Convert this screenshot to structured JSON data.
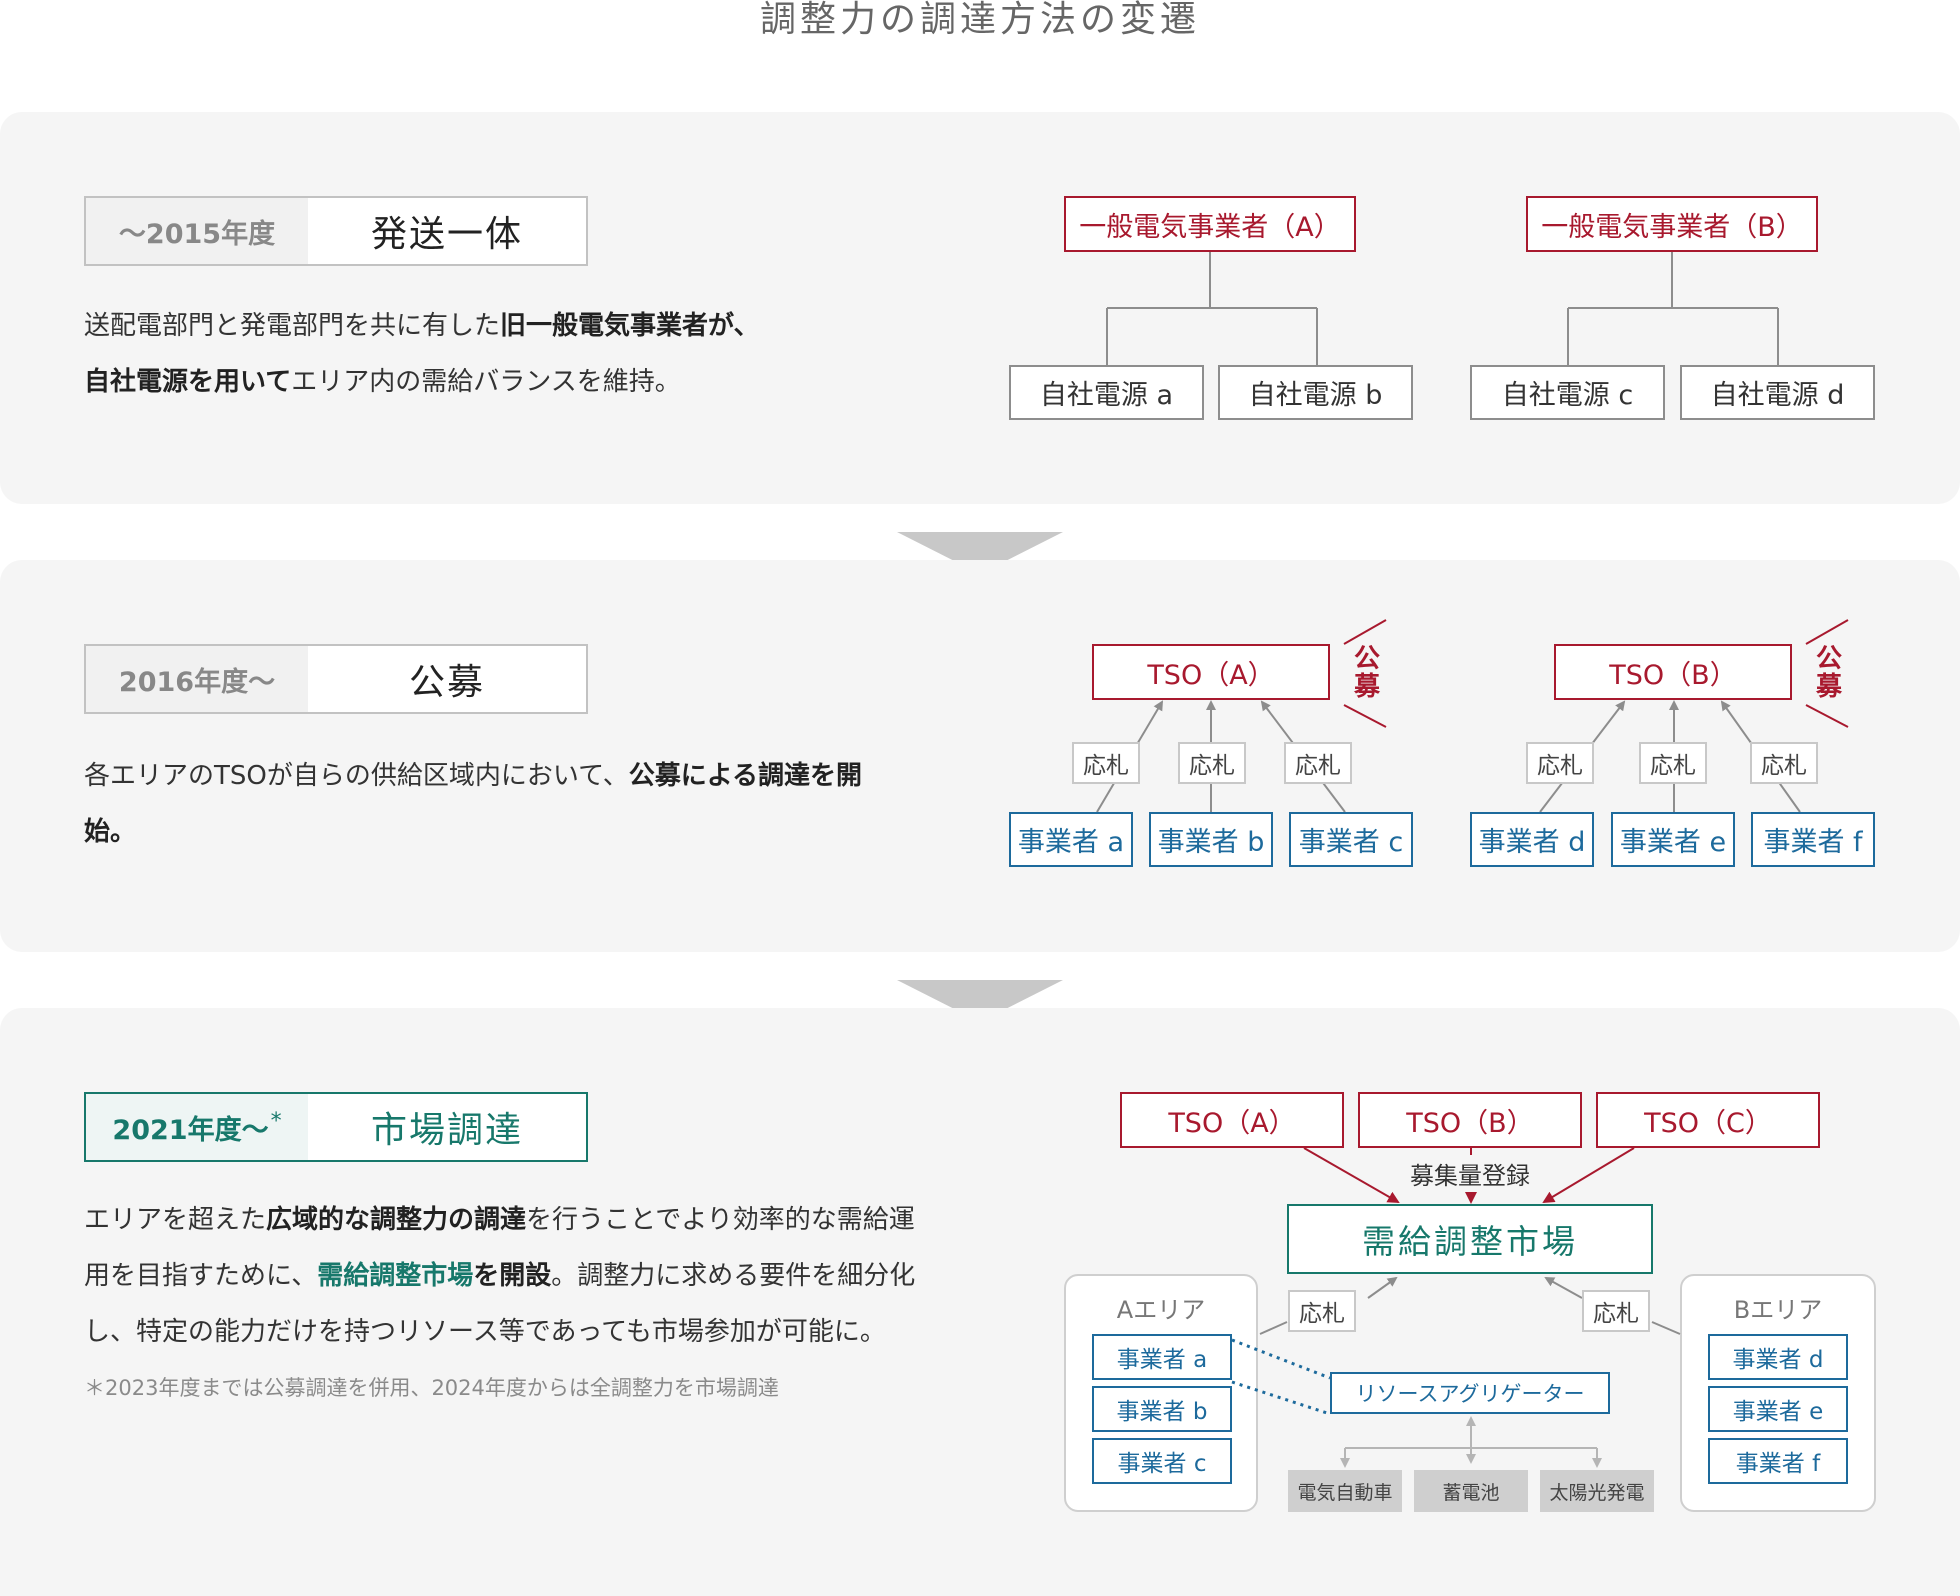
{
  "title": "調整力の調達方法の変遷",
  "colors": {
    "red": "#a8192e",
    "blue": "#1d6a9c",
    "green": "#17786b",
    "panel": "#f5f5f5"
  },
  "s1": {
    "year": "～2015年度",
    "name": "発送一体",
    "desc": {
      "l1a": "送配電部門と発電部門を共に有した",
      "l1b": "旧一般電気事業者が、",
      "l2a": "自社電源を用いて",
      "l2b": "エリア内の需給バランスを維持。"
    },
    "utilA": "一般電気事業者（A）",
    "utilB": "一般電気事業者（B）",
    "sources": [
      "自社電源 a",
      "自社電源 b",
      "自社電源 c",
      "自社電源 d"
    ]
  },
  "s2": {
    "year": "2016年度～",
    "name": "公募",
    "desc": {
      "l1a": "各エリアのTSOが自らの供給区域内において、",
      "l1b": "公募による調達を開",
      "l2": "始。"
    },
    "tsoA": "TSO（A）",
    "tsoB": "TSO（B）",
    "koubo": "公募",
    "bid": "応札",
    "operators": [
      "事業者 a",
      "事業者 b",
      "事業者 c",
      "事業者 d",
      "事業者 e",
      "事業者 f"
    ]
  },
  "s3": {
    "year": "2021年度～",
    "asterisk": "*",
    "name": "市場調達",
    "desc": {
      "l1a": "エリアを超えた",
      "l1b": "広域的な調整力の調達",
      "l1c": "を行うことでより効率的な需給運",
      "l2a": "用を目指すために、",
      "l2b": "需給調整市場",
      "l2c": "を開設",
      "l2d": "。調整力に求める要件を細分化",
      "l3": "し、特定の能力だけを持つリソース等であっても市場参加が可能に。"
    },
    "note": "＊2023年度までは公募調達を併用、2024年度からは全調整力を市場調達",
    "tsos": [
      "TSO（A）",
      "TSO（B）",
      "TSO（C）"
    ],
    "registration": "募集量登録",
    "market": "需給調整市場",
    "bid": "応札",
    "areaA": "Aエリア",
    "areaB": "Bエリア",
    "opsA": [
      "事業者 a",
      "事業者 b",
      "事業者 c"
    ],
    "opsB": [
      "事業者 d",
      "事業者 e",
      "事業者 f"
    ],
    "aggregator": "リソースアグリゲーター",
    "resources": [
      "電気自動車",
      "蓄電池",
      "太陽光発電"
    ]
  }
}
